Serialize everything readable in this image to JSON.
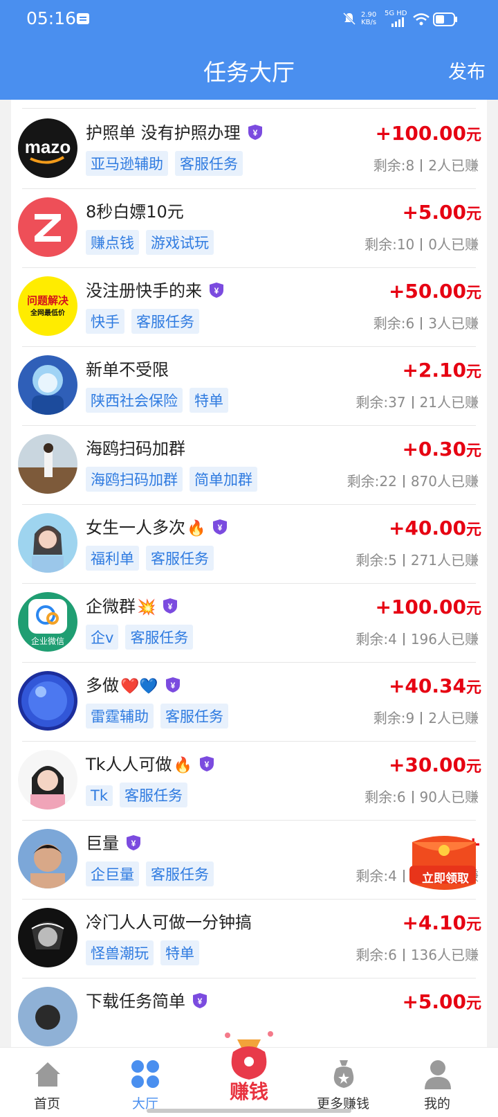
{
  "status_bar": {
    "time": "05:16",
    "net_speed_top": "2.90",
    "net_speed_unit": "KB/s",
    "network": "5G HD"
  },
  "header": {
    "title": "任务大厅",
    "publish_label": "发布"
  },
  "colors": {
    "brand_blue": "#4a8fef",
    "price_red": "#e60012",
    "tag_bg": "#e8f1fc",
    "tag_text": "#2f7be0"
  },
  "tasks": [
    {
      "title": "护照单 没有护照办理",
      "emoji": "",
      "vip": true,
      "tags": [
        "亚马逊辅助",
        "客服任务"
      ],
      "price": "+100.00",
      "unit": "元",
      "remaining": "剩余:8",
      "earned": "2人已赚",
      "avatar": "amazon-logo-avatar"
    },
    {
      "title": "8秒白嫖10元",
      "emoji": "",
      "vip": false,
      "tags": [
        "赚点钱",
        "游戏试玩"
      ],
      "price": "+5.00",
      "unit": "元",
      "remaining": "剩余:10",
      "earned": "0人已赚",
      "avatar": "z-logo-avatar"
    },
    {
      "title": "没注册快手的来",
      "emoji": "",
      "vip": true,
      "tags": [
        "快手",
        "客服任务"
      ],
      "price": "+50.00",
      "unit": "元",
      "remaining": "剩余:6",
      "earned": "3人已赚",
      "avatar": "problem-solve-avatar",
      "avatar_text_1": "问题解决",
      "avatar_text_2": "全网最低价"
    },
    {
      "title": "新单不受限",
      "emoji": "",
      "vip": false,
      "tags": [
        "陕西社会保险",
        "特单"
      ],
      "price": "+2.10",
      "unit": "元",
      "remaining": "剩余:37",
      "earned": "21人已赚",
      "avatar": "cartoon-avatar"
    },
    {
      "title": "海鸥扫码加群",
      "emoji": "",
      "vip": false,
      "tags": [
        "海鸥扫码加群",
        "简单加群"
      ],
      "price": "+0.30",
      "unit": "元",
      "remaining": "剩余:22",
      "earned": "870人已赚",
      "avatar": "travel-photo-avatar"
    },
    {
      "title": "女生一人多次",
      "emoji": "🔥",
      "vip": true,
      "tags": [
        "福利单",
        "客服任务"
      ],
      "price": "+40.00",
      "unit": "元",
      "remaining": "剩余:5",
      "earned": "271人已赚",
      "avatar": "girl-photo-avatar"
    },
    {
      "title": "企微群",
      "emoji": "💥",
      "vip": true,
      "tags": [
        "企v",
        "客服任务"
      ],
      "price": "+100.00",
      "unit": "元",
      "remaining": "剩余:4",
      "earned": "196人已赚",
      "avatar": "wecom-logo-avatar",
      "avatar_text_1": "企业微信"
    },
    {
      "title": "多做",
      "emoji": "❤️💙",
      "vip": true,
      "tags": [
        "雷霆辅助",
        "客服任务"
      ],
      "price": "+40.34",
      "unit": "元",
      "remaining": "剩余:9",
      "earned": "2人已赚",
      "avatar": "blue-orb-avatar"
    },
    {
      "title": "Tk人人可做",
      "emoji": "🔥",
      "vip": true,
      "tags": [
        "Tk",
        "客服任务"
      ],
      "price": "+30.00",
      "unit": "元",
      "remaining": "剩余:6",
      "earned": "90人已赚",
      "avatar": "woman-photo-avatar"
    },
    {
      "title": "巨量",
      "emoji": "",
      "vip": true,
      "tags": [
        "企巨量",
        "客服任务"
      ],
      "price": "+",
      "unit": "",
      "remaining": "剩余:4",
      "earned": "313人已赚",
      "avatar": "man-photo-avatar"
    },
    {
      "title": "冷门人人可做一分钟搞",
      "emoji": "",
      "vip": false,
      "tags": [
        "怪兽潮玩",
        "特单"
      ],
      "price": "+4.10",
      "unit": "元",
      "remaining": "剩余:6",
      "earned": "136人已赚",
      "avatar": "sketch-avatar"
    },
    {
      "title": "下载任务简单",
      "emoji": "",
      "vip": true,
      "tags": [],
      "price": "+5.00",
      "unit": "元",
      "remaining": "",
      "earned": "",
      "avatar": "partial-avatar"
    }
  ],
  "floating_redpack": {
    "label": "立即领取"
  },
  "bottom_nav": [
    {
      "label": "首页",
      "icon": "home-icon",
      "active": false
    },
    {
      "label": "大厅",
      "icon": "grid-icon",
      "active": true
    },
    {
      "label": "赚钱",
      "icon": "money-bag-icon",
      "active": false
    },
    {
      "label": "更多赚钱",
      "icon": "coin-bag-icon",
      "active": false
    },
    {
      "label": "我的",
      "icon": "user-icon",
      "active": false
    }
  ]
}
